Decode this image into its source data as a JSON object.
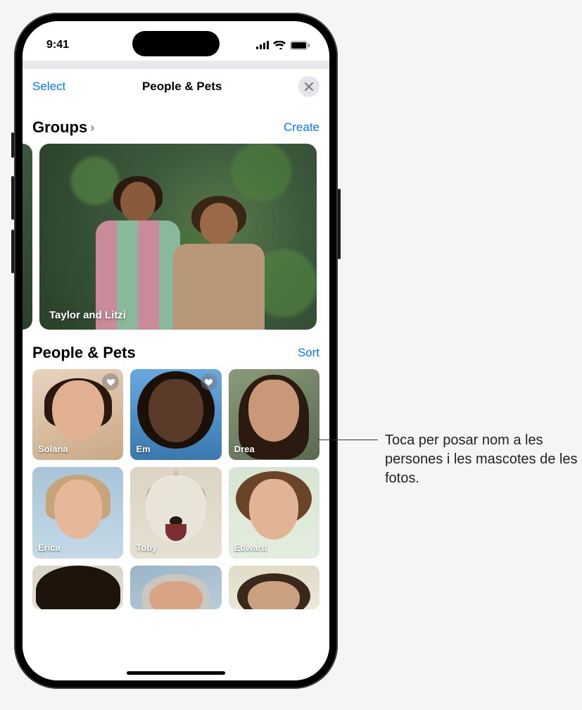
{
  "status": {
    "time": "9:41"
  },
  "sheet": {
    "select": "Select",
    "title": "People & Pets"
  },
  "groups": {
    "heading": "Groups",
    "create": "Create",
    "card_label": "Taylor and Litzi"
  },
  "people": {
    "heading": "People & Pets",
    "sort": "Sort",
    "items": [
      {
        "name": "Solana",
        "favorite": true
      },
      {
        "name": "Em",
        "favorite": true
      },
      {
        "name": "Drea",
        "favorite": false
      },
      {
        "name": "Erica",
        "favorite": false
      },
      {
        "name": "Toby",
        "favorite": false
      },
      {
        "name": "Edward",
        "favorite": false
      }
    ]
  },
  "callout": "Toca per posar nom a les persones i les mascotes de les fotos."
}
